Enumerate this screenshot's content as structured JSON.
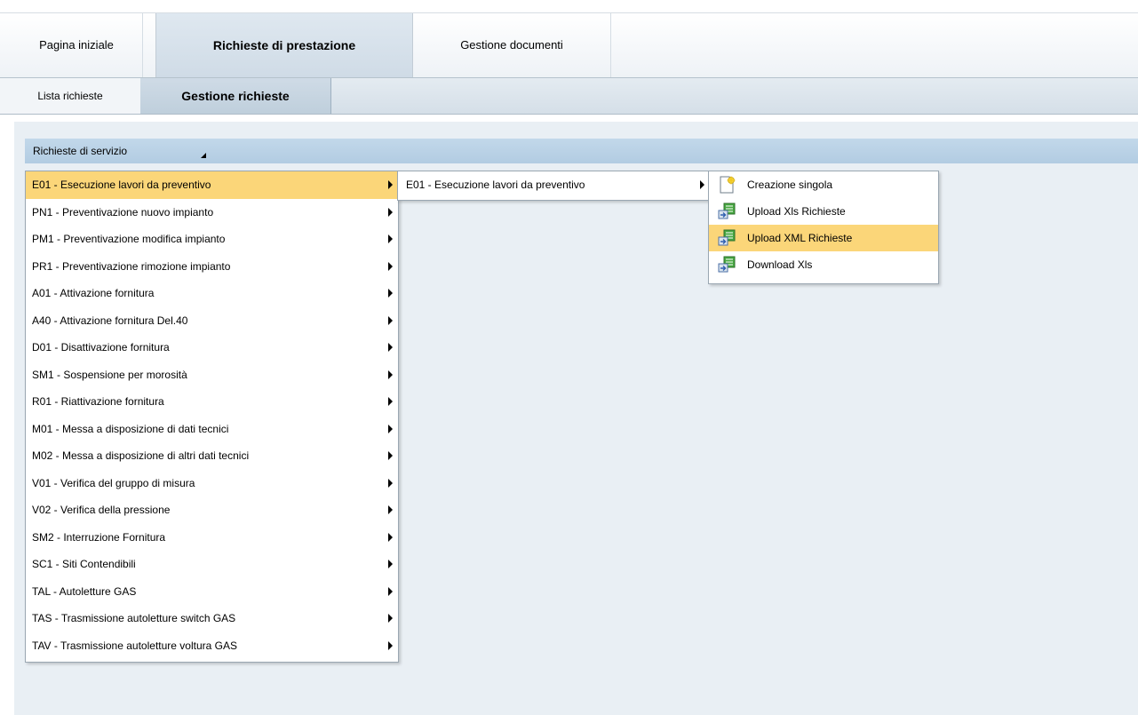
{
  "tabs": [
    {
      "label": "Pagina iniziale"
    },
    {
      "label": "Richieste di prestazione"
    },
    {
      "label": "Gestione documenti"
    }
  ],
  "subtabs": [
    {
      "label": "Lista richieste"
    },
    {
      "label": "Gestione richieste"
    }
  ],
  "menu": {
    "header": "Richieste di servizio",
    "items": [
      {
        "label": "E01 - Esecuzione lavori da preventivo"
      },
      {
        "label": "PN1 - Preventivazione nuovo impianto"
      },
      {
        "label": "PM1 - Preventivazione modifica impianto"
      },
      {
        "label": "PR1 - Preventivazione rimozione impianto"
      },
      {
        "label": "A01 - Attivazione fornitura"
      },
      {
        "label": "A40 - Attivazione fornitura Del.40"
      },
      {
        "label": "D01 - Disattivazione fornitura"
      },
      {
        "label": "SM1 - Sospensione per morosità"
      },
      {
        "label": "R01 - Riattivazione fornitura"
      },
      {
        "label": "M01 - Messa a disposizione di dati tecnici"
      },
      {
        "label": "M02 - Messa a disposizione di altri dati tecnici"
      },
      {
        "label": "V01 - Verifica del gruppo di misura"
      },
      {
        "label": "V02 - Verifica della pressione"
      },
      {
        "label": "SM2 - Interruzione Fornitura"
      },
      {
        "label": "SC1 - Siti Contendibili"
      },
      {
        "label": "TAL - Autoletture GAS"
      },
      {
        "label": "TAS - Trasmissione autoletture switch GAS"
      },
      {
        "label": "TAV - Trasmissione autoletture voltura GAS"
      }
    ],
    "submenu": {
      "label": "E01 - Esecuzione lavori da preventivo"
    },
    "actions": [
      {
        "label": "Creazione singola",
        "icon": "new-document-icon"
      },
      {
        "label": "Upload Xls Richieste",
        "icon": "upload-icon"
      },
      {
        "label": "Upload XML Richieste",
        "icon": "upload-icon"
      },
      {
        "label": "Download Xls",
        "icon": "download-icon"
      }
    ]
  },
  "colors": {
    "highlight": "#fbd679",
    "header_bar": "#b8d0e5",
    "content_bg": "#e9eff4"
  }
}
